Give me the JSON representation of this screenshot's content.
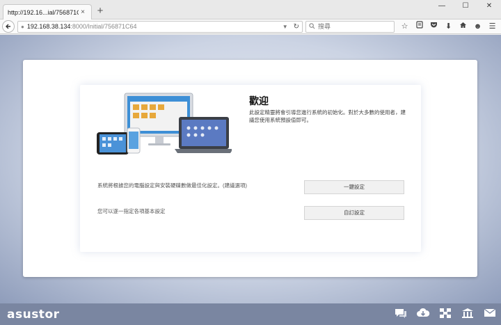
{
  "browser": {
    "tab_title": "http://192.16...ial/756871C64",
    "tab_close": "×",
    "new_tab": "+",
    "window_controls": [
      "—",
      "☐",
      "✕"
    ],
    "url_host": "192.168.38.134",
    "url_path": ":8000/Initial/756871C64",
    "search_placeholder": "搜尋",
    "toolbar_icons": [
      "bookmark-star-icon",
      "reading-list-icon",
      "pocket-icon",
      "download-icon",
      "home-icon",
      "emoji-icon",
      "menu-icon"
    ]
  },
  "welcome": {
    "title": "歡迎",
    "description": "此設定精靈將會引導您進行系統的初始化。對於大多數的使用者，建議您使用系統預設值即可。"
  },
  "options": [
    {
      "text": "系統將根據您的電腦設定與安裝硬碟數做最佳化設定。(建議選項)",
      "button": "一鍵設定"
    },
    {
      "text": "您可以逐一指定各項基本設定",
      "button": "自訂設定"
    }
  ],
  "footer": {
    "logo": "asustor",
    "icons": [
      "chat-icon",
      "cloud-download-icon",
      "network-icon",
      "bank-icon",
      "mail-icon"
    ]
  }
}
